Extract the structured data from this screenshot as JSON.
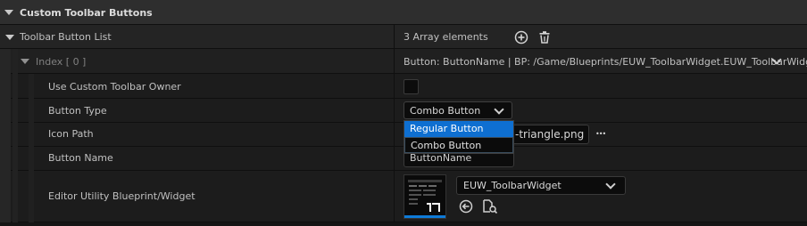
{
  "section": {
    "title": "Custom Toolbar Buttons"
  },
  "array_row": {
    "label": "Toolbar Button List",
    "value": "3 Array elements",
    "add_icon": "add-circle-icon",
    "delete_icon": "trash-icon"
  },
  "index_row": {
    "label": "Index [ 0 ]",
    "value": "Button: ButtonName | BP: /Game/Blueprints/EUW_ToolbarWidget.EUW_ToolbarWidget"
  },
  "properties": {
    "owner": {
      "label": "Use Custom Toolbar Owner",
      "checked": false
    },
    "type": {
      "label": "Button Type",
      "selected": "Combo Button",
      "options": [
        "Regular Button",
        "Combo Button"
      ],
      "highlighted": "Regular Button"
    },
    "icon_path": {
      "label": "Icon Path",
      "value": "-triangle.png",
      "more": "•••"
    },
    "name": {
      "label": "Button Name",
      "value": "ButtonName"
    },
    "widget": {
      "label": "Editor Utility Blueprint/Widget",
      "asset": "EUW_ToolbarWidget",
      "use_icon": "arrow-left-circle-icon",
      "browse_icon": "browse-folder-icon"
    }
  },
  "colors": {
    "accent": "#0e6fd1",
    "background": "#151515",
    "header": "#2e2e2e"
  }
}
